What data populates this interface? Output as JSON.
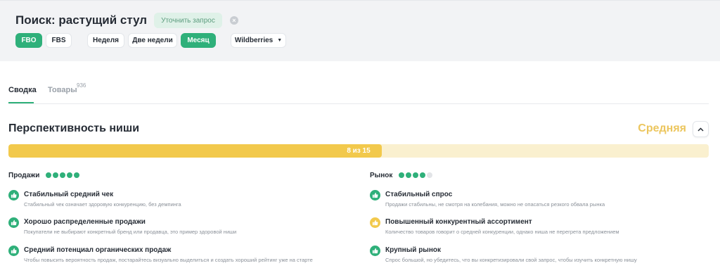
{
  "header": {
    "title": "Поиск: растущий стул",
    "refine_label": "Уточнить запрос",
    "clear_icon": "close-icon"
  },
  "filters": {
    "fbo": "FBO",
    "fbs": "FBS",
    "week": "Неделя",
    "two_weeks": "Две недели",
    "month": "Месяц",
    "marketplace": "Wildberries",
    "active": [
      "FBO",
      "Месяц"
    ]
  },
  "tabs": {
    "summary": "Сводка",
    "goods": "Товары",
    "goods_count": "936"
  },
  "niche": {
    "title": "Перспективность ниши",
    "rating": "Средняя",
    "score_label": "8 из 15",
    "score": 8,
    "score_max": 15
  },
  "sales": {
    "title": "Продажи",
    "dots_on": 5,
    "dots_total": 5,
    "items": [
      {
        "title": "Стабильный средний чек",
        "desc": "Стабильный чек означает здоровую конкуренцию, без демпинга",
        "status": "good"
      },
      {
        "title": "Хорошо распределенные продажи",
        "desc": "Покупатели не выбирают конкретный бренд или продавца, это пример здоровой ниши",
        "status": "good"
      },
      {
        "title": "Средний потенциал органических продаж",
        "desc": "Чтобы повысить вероятность продаж, постарайтесь визуально выделиться и создать хороший рейтинг уже на старте",
        "status": "good"
      }
    ]
  },
  "market": {
    "title": "Рынок",
    "dots_on": 4,
    "dots_total": 5,
    "items": [
      {
        "title": "Стабильный спрос",
        "desc": "Продажи стабильны, не смотря на колебания, можно не опасаться резкого обвала рынка",
        "status": "good"
      },
      {
        "title": "Повышенный конкурентный ассортимент",
        "desc": "Количество товаров говорит о средней конкуренции, однако ниша не перегрета предложением",
        "status": "warn"
      },
      {
        "title": "Крупный рынок",
        "desc": "Спрос большой, но убедитесь, что вы конкретизировали свой запрос, чтобы изучить конкретную нишу",
        "status": "good"
      }
    ]
  },
  "colors": {
    "accent": "#2fb07a",
    "rating": "#ecc65e",
    "bar_fill": "#f2c94c",
    "bar_track": "#faf0cf"
  }
}
